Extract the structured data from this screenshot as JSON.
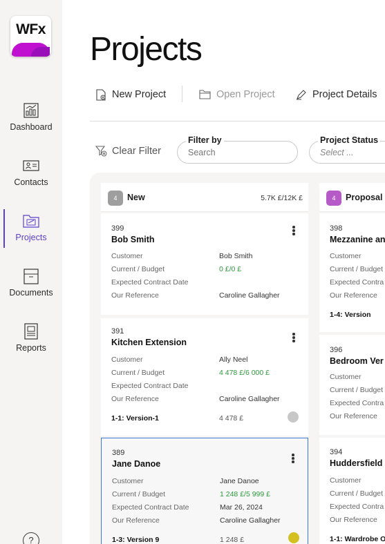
{
  "sidebar": {
    "logo_text": "WFx",
    "items": [
      {
        "label": "Dashboard",
        "icon": "dashboard-icon"
      },
      {
        "label": "Contacts",
        "icon": "contacts-icon"
      },
      {
        "label": "Projects",
        "icon": "projects-icon"
      },
      {
        "label": "Documents",
        "icon": "documents-icon"
      },
      {
        "label": "Reports",
        "icon": "reports-icon"
      }
    ],
    "active": "Projects",
    "help_label": "?"
  },
  "page": {
    "title": "Projects"
  },
  "toolbar": {
    "new_project": "New Project",
    "open_project": "Open Project",
    "project_details": "Project Details"
  },
  "filters": {
    "clear_filter": "Clear Filter",
    "filter_by_label": "Filter by",
    "search_placeholder": "Search",
    "status_label": "Project Status",
    "status_value": "Select ..."
  },
  "columns": [
    {
      "count": "4",
      "title": "New",
      "total": "5.7K £/12K £",
      "badge_color": "#9e9e9e",
      "cards": [
        {
          "number": "399",
          "name": "Bob Smith",
          "rows": [
            {
              "label": "Customer",
              "value": "Bob Smith"
            },
            {
              "label": "Current / Budget",
              "value": "0 £/0 £"
            },
            {
              "label": "Expected Contract Date",
              "value": ""
            },
            {
              "label": "Our Reference",
              "value": "Caroline Gallagher"
            }
          ],
          "footer_label": "",
          "footer_value": "",
          "status_color": ""
        },
        {
          "number": "391",
          "name": "Kitchen Extension",
          "rows": [
            {
              "label": "Customer",
              "value": "Ally Neel"
            },
            {
              "label": "Current / Budget",
              "value": "4 478 £/6 000 £"
            },
            {
              "label": "Expected Contract Date",
              "value": ""
            },
            {
              "label": "Our Reference",
              "value": "Caroline Gallagher"
            }
          ],
          "footer_label": "1-1: Version-1",
          "footer_value": "4 478 £",
          "status_color": "#c8c8c8"
        },
        {
          "number": "389",
          "name": "Jane Danoe",
          "rows": [
            {
              "label": "Customer",
              "value": "Jane Danoe"
            },
            {
              "label": "Current / Budget",
              "value": "1 248 £/5 999 £"
            },
            {
              "label": "Expected Contract Date",
              "value": "Mar 26, 2024"
            },
            {
              "label": "Our Reference",
              "value": "Caroline Gallagher"
            }
          ],
          "footer_label": "1-3: Version 9",
          "footer_value": "1 248 £",
          "status_color": "#d4c020"
        }
      ]
    },
    {
      "count": "4",
      "title": "Proposal",
      "total": "",
      "badge_color": "#b65ac8",
      "cards": [
        {
          "number": "398",
          "name": "Mezzanine an",
          "rows": [
            {
              "label": "Customer"
            },
            {
              "label": "Current / Budget"
            },
            {
              "label": "Expected Contra"
            },
            {
              "label": "Our Reference"
            }
          ],
          "footer_label": "1-4: Version"
        },
        {
          "number": "396",
          "name": "Bedroom Ver",
          "rows": [
            {
              "label": "Customer"
            },
            {
              "label": "Current / Budget"
            },
            {
              "label": "Expected Contra"
            },
            {
              "label": "Our Reference"
            }
          ],
          "footer_label": ""
        },
        {
          "number": "394",
          "name": "Huddersfield",
          "rows": [
            {
              "label": "Customer"
            },
            {
              "label": "Current / Budget"
            },
            {
              "label": "Expected Contra"
            },
            {
              "label": "Our Reference"
            }
          ],
          "footer_label": "1-1: Wardrobe O"
        }
      ]
    }
  ],
  "colors": {
    "accent": "#5a3fd0",
    "selected_border": "#3c78d8",
    "money_green": "#2a9a3a"
  }
}
